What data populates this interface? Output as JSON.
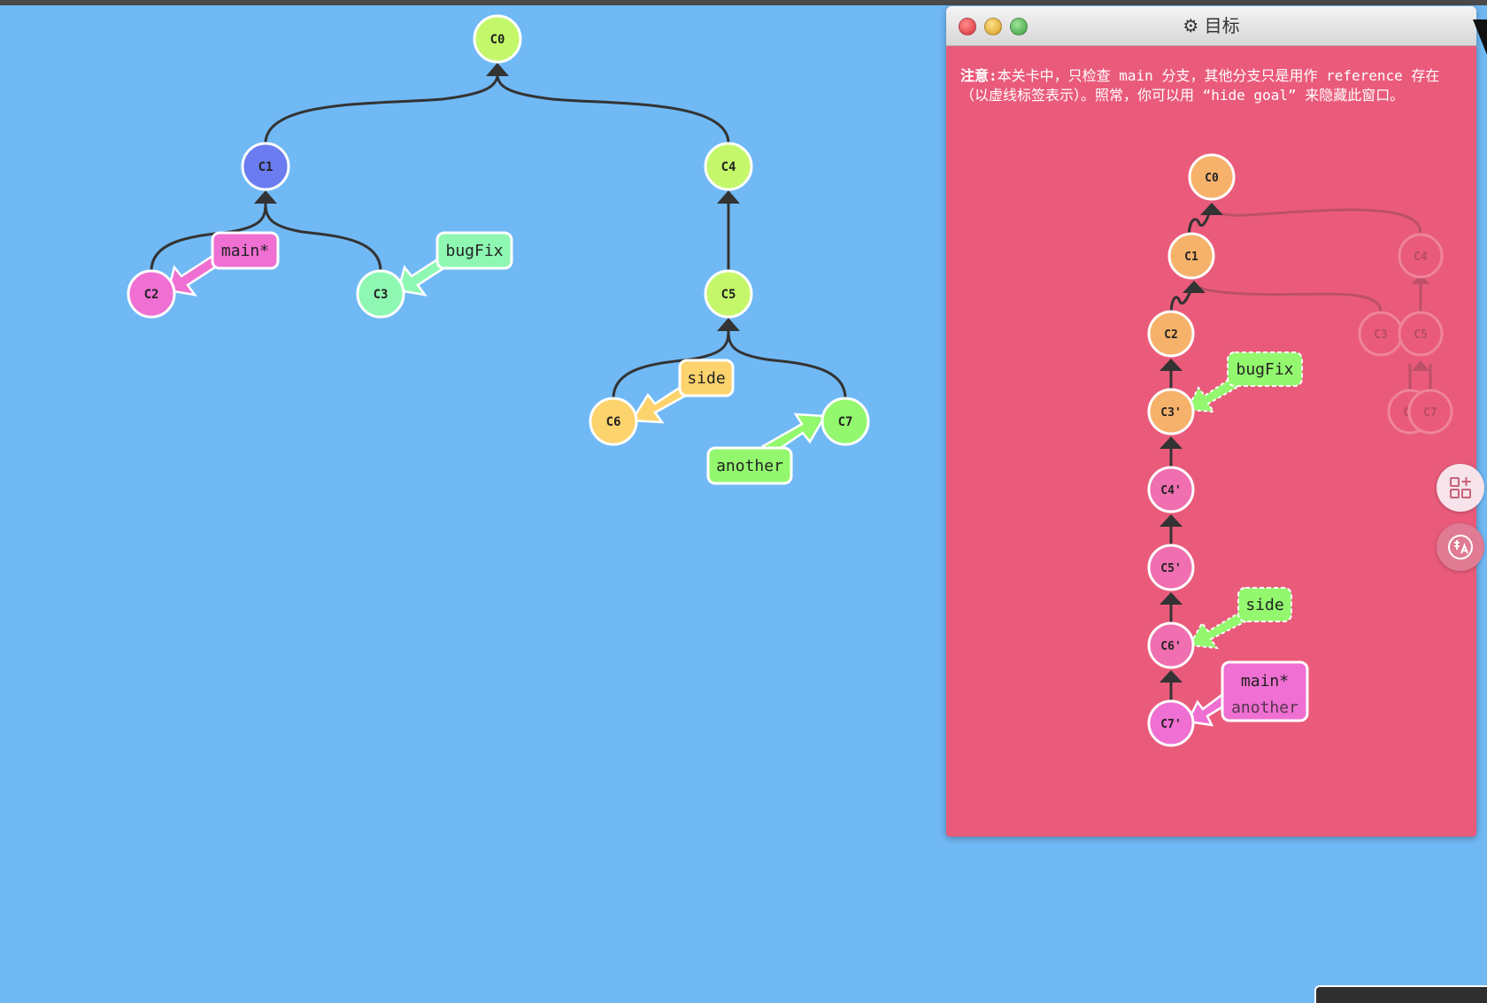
{
  "main_tree": {
    "commits": [
      {
        "id": "C0",
        "color": "#c4f86a"
      },
      {
        "id": "C1",
        "color": "#6b7cf0"
      },
      {
        "id": "C2",
        "color": "#ef6fd2"
      },
      {
        "id": "C3",
        "color": "#8ef8b3"
      },
      {
        "id": "C4",
        "color": "#c4f86a"
      },
      {
        "id": "C5",
        "color": "#c4f86a"
      },
      {
        "id": "C6",
        "color": "#fcd36c"
      },
      {
        "id": "C7",
        "color": "#93f86e"
      }
    ],
    "branches": [
      {
        "name": "main*",
        "target": "C2",
        "color": "#ef6fd2"
      },
      {
        "name": "bugFix",
        "target": "C3",
        "color": "#8ef8b3"
      },
      {
        "name": "side",
        "target": "C6",
        "color": "#fcd36c"
      },
      {
        "name": "another",
        "target": "C7",
        "color": "#93f86e"
      }
    ]
  },
  "goal_window": {
    "title": "目标",
    "title_icon": "gear-icon",
    "note_bold": "注意:",
    "note_text": "本关卡中，只检查 main 分支，其他分支只是用作 reference 存在（以虚线标签表示）。照常，你可以用 “hide goal” 来隐藏此窗口。",
    "background": "#ea5b7b",
    "commits": [
      {
        "id": "C0",
        "color": "#f6b26b"
      },
      {
        "id": "C1",
        "color": "#f6b26b"
      },
      {
        "id": "C2",
        "color": "#f6b26b"
      },
      {
        "id": "C3'",
        "color": "#f6b26b"
      },
      {
        "id": "C4'",
        "color": "#ef6fb0"
      },
      {
        "id": "C5'",
        "color": "#ef6fb0"
      },
      {
        "id": "C6'",
        "color": "#ef6fb0"
      },
      {
        "id": "C7'",
        "color": "#ef6fd2"
      },
      {
        "id": "C4",
        "color": "#ea5b7b"
      },
      {
        "id": "C3",
        "color": "#ea5b7b"
      },
      {
        "id": "C5",
        "color": "#ea5b7b"
      },
      {
        "id": "C6",
        "color": "#ea5b7b"
      },
      {
        "id": "C7",
        "color": "#ea5b7b"
      }
    ],
    "branches": [
      {
        "name": "bugFix",
        "target": "C3'",
        "color": "#93f86e"
      },
      {
        "name": "side",
        "target": "C6'",
        "color": "#93f86e"
      },
      {
        "name": "main*",
        "target": "C7'",
        "color": "#ef6fd2"
      },
      {
        "name": "another",
        "target": "C7'",
        "color": "#ef6fd2"
      }
    ]
  },
  "side_buttons": {
    "apps_icon": "apps-plus-icon",
    "translate_icon": "translate-icon"
  }
}
